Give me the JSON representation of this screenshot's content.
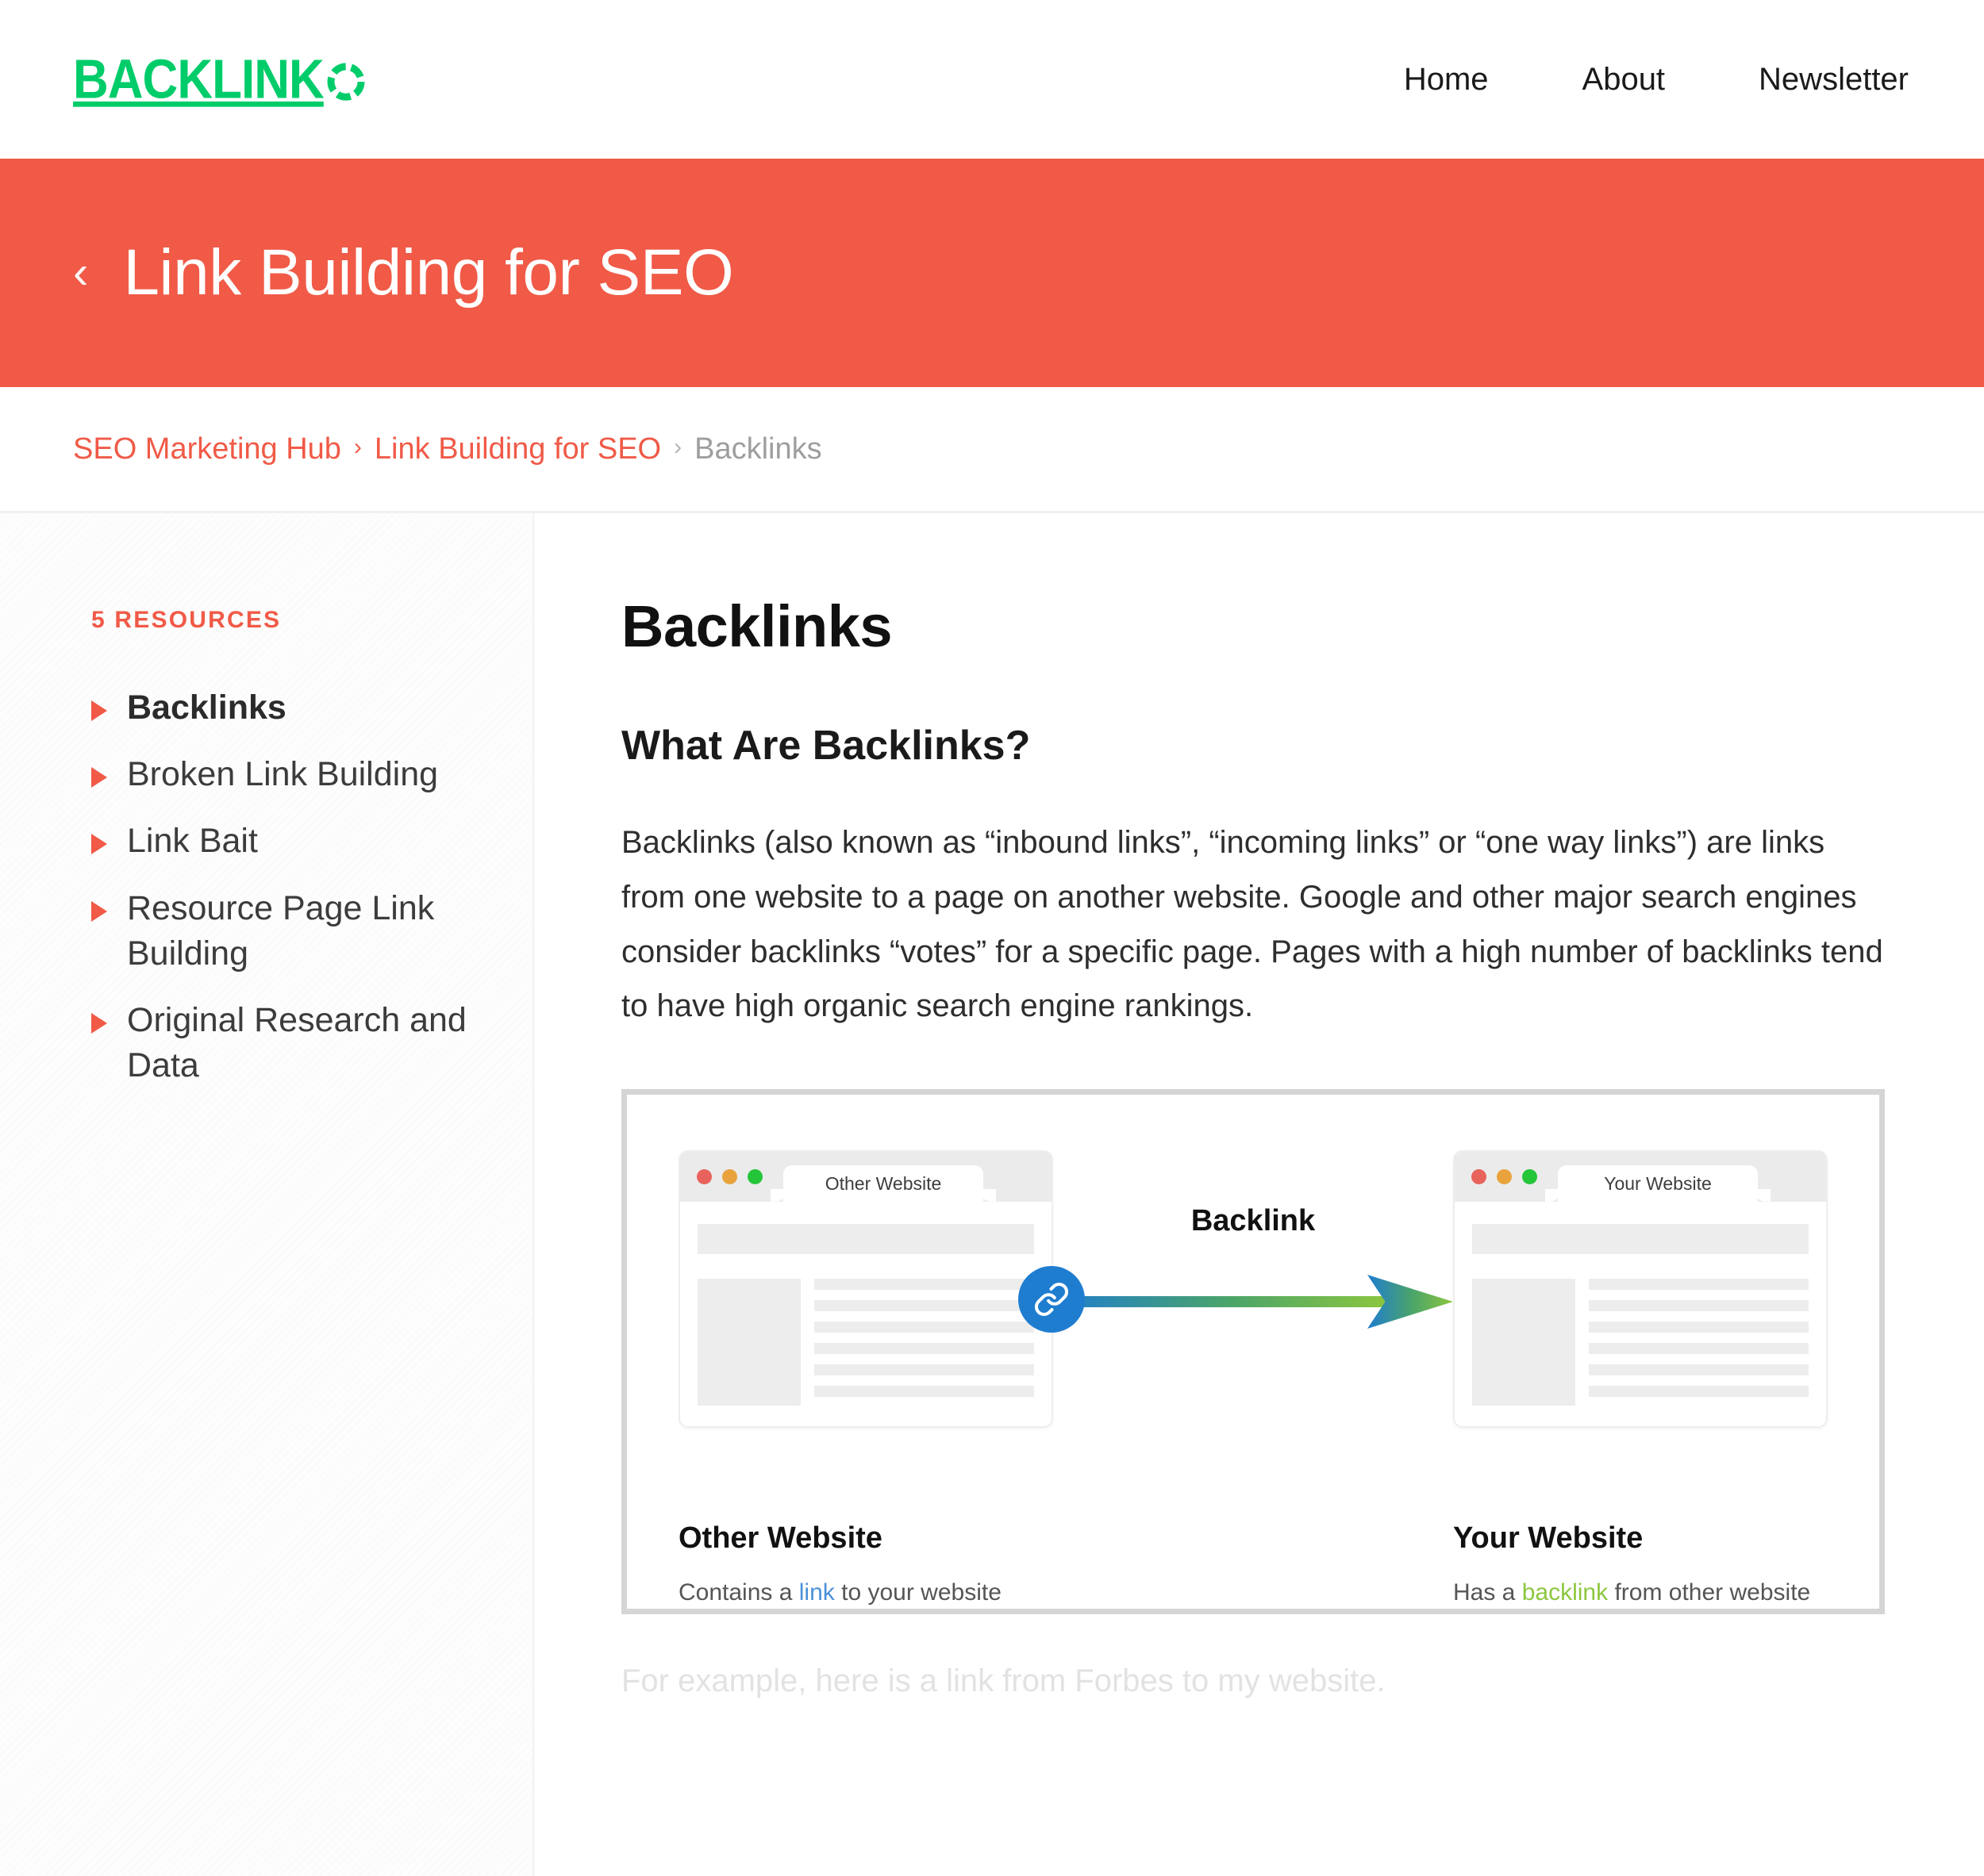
{
  "header": {
    "logo_text": "BACKLINK",
    "logo_icon": "dashed-circle-o",
    "nav": [
      {
        "label": "Home"
      },
      {
        "label": "About"
      },
      {
        "label": "Newsletter"
      }
    ]
  },
  "banner": {
    "back_icon": "‹",
    "title": "Link Building for SEO",
    "background_color": "#F05A47"
  },
  "breadcrumb": {
    "separator": "›",
    "items": [
      {
        "label": "SEO Marketing Hub",
        "current": false
      },
      {
        "label": "Link Building for SEO",
        "current": false
      },
      {
        "label": "Backlinks",
        "current": true
      }
    ]
  },
  "sidebar": {
    "heading": "5 RESOURCES",
    "items": [
      {
        "label": "Backlinks",
        "active": true
      },
      {
        "label": "Broken Link Building",
        "active": false
      },
      {
        "label": "Link Bait",
        "active": false
      },
      {
        "label": "Resource Page Link Building",
        "active": false
      },
      {
        "label": "Original Research and Data",
        "active": false
      }
    ]
  },
  "main": {
    "page_title": "Backlinks",
    "section_heading": "What Are Backlinks?",
    "paragraph": "Backlinks (also known as “inbound links”, “incoming links” or “one way links”) are links from one website to a page on another website. Google and other major search engines consider backlinks “votes” for a specific page. Pages with a high number of backlinks tend to have high organic search engine rankings.",
    "footer_note": "For example, here is a link from Forbes to my website."
  },
  "diagram": {
    "arrow_label": "Backlink",
    "arrow_gradient_start": "#1f7dd0",
    "arrow_gradient_end": "#8cc63f",
    "link_badge_color": "#1f7dd0",
    "link_badge_icon": "chain-link-icon",
    "left": {
      "tab_label": "Other Website",
      "caption_title": "Other Website",
      "caption_prefix": "Contains a ",
      "caption_highlight": "link",
      "caption_suffix": " to your website",
      "highlight_color": "#4a90d9"
    },
    "right": {
      "tab_label": "Your Website",
      "caption_title": "Your Website",
      "caption_prefix": "Has a ",
      "caption_highlight": "backlink",
      "caption_suffix": " from other website",
      "highlight_color": "#8cc63f"
    },
    "window_dots": [
      "#e8635b",
      "#e8a33d",
      "#25c53a"
    ]
  }
}
